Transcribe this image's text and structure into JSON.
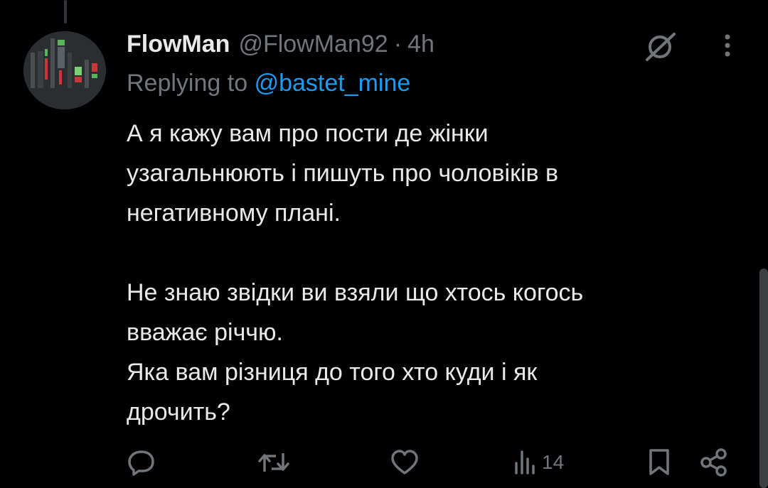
{
  "tweet": {
    "display_name": "FlowMan",
    "handle": "@FlowMan92",
    "separator": "·",
    "time": "4h",
    "replying_prefix": "Replying to",
    "replying_to": "@bastet_mine",
    "body_lines": [
      "А я кажу вам про пости де жінки",
      "узагальнюють і пишуть про чоловіків в",
      "негативному плані.",
      "",
      "Не знаю звідки ви взяли що хтось когось",
      "вважає річчю.",
      "Яка вам різниця до того хто куди і як",
      "дрочить?"
    ]
  },
  "actions": {
    "views": "14"
  },
  "icons": {
    "reply": "reply-icon",
    "retweet": "retweet-icon",
    "like": "heart-icon",
    "views": "views-icon",
    "bookmark": "bookmark-icon",
    "share": "share-icon",
    "grok": "grok-icon",
    "more": "more-icon"
  },
  "colors": {
    "background": "#000000",
    "text": "#e7e9ea",
    "secondary": "#71767b",
    "link": "#1d9bf0"
  }
}
